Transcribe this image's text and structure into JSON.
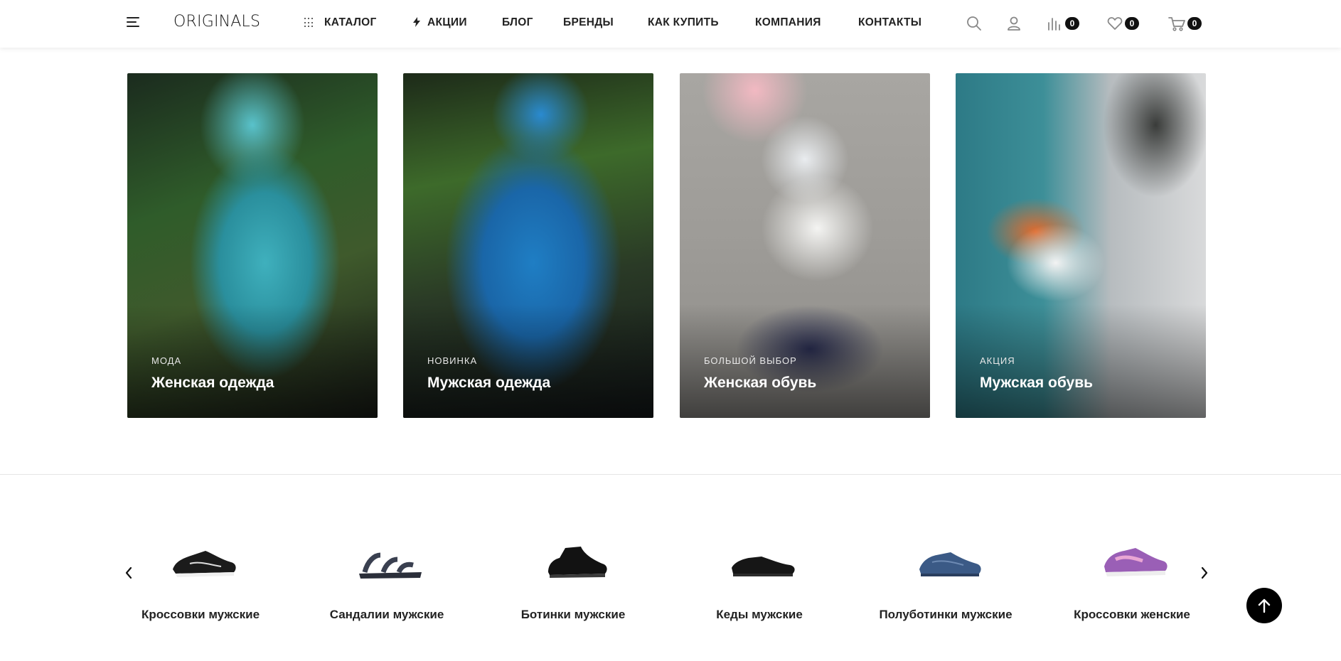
{
  "header": {
    "logo": "ORIGINALS",
    "nav": [
      {
        "label": "КАТАЛОГ"
      },
      {
        "label": "АКЦИИ"
      },
      {
        "label": "БЛОГ"
      },
      {
        "label": "БРЕНДЫ"
      },
      {
        "label": "КАК КУПИТЬ"
      },
      {
        "label": "КОМПАНИЯ"
      },
      {
        "label": "КОНТАКТЫ"
      }
    ],
    "icons": {
      "search": "search-icon",
      "account": "user-icon",
      "compare": "compare-icon",
      "favorites": "heart-icon",
      "cart": "cart-icon"
    },
    "compare_count": "0",
    "favorites_count": "0",
    "cart_count": "0"
  },
  "banners": [
    {
      "tag": "МОДА",
      "title": "Женская одежда"
    },
    {
      "tag": "НОВИНКА",
      "title": "Мужская одежда"
    },
    {
      "tag": "БОЛЬШОЙ ВЫБОР",
      "title": "Женская обувь"
    },
    {
      "tag": "АКЦИЯ",
      "title": "Мужская обувь"
    }
  ],
  "categories": [
    {
      "label": "Кроссовки мужские"
    },
    {
      "label": "Сандалии мужские"
    },
    {
      "label": "Ботинки мужские"
    },
    {
      "label": "Кеды мужские"
    },
    {
      "label": "Полуботинки мужские"
    },
    {
      "label": "Кроссовки женские"
    }
  ],
  "controls": {
    "prev": "‹",
    "next": "›"
  }
}
